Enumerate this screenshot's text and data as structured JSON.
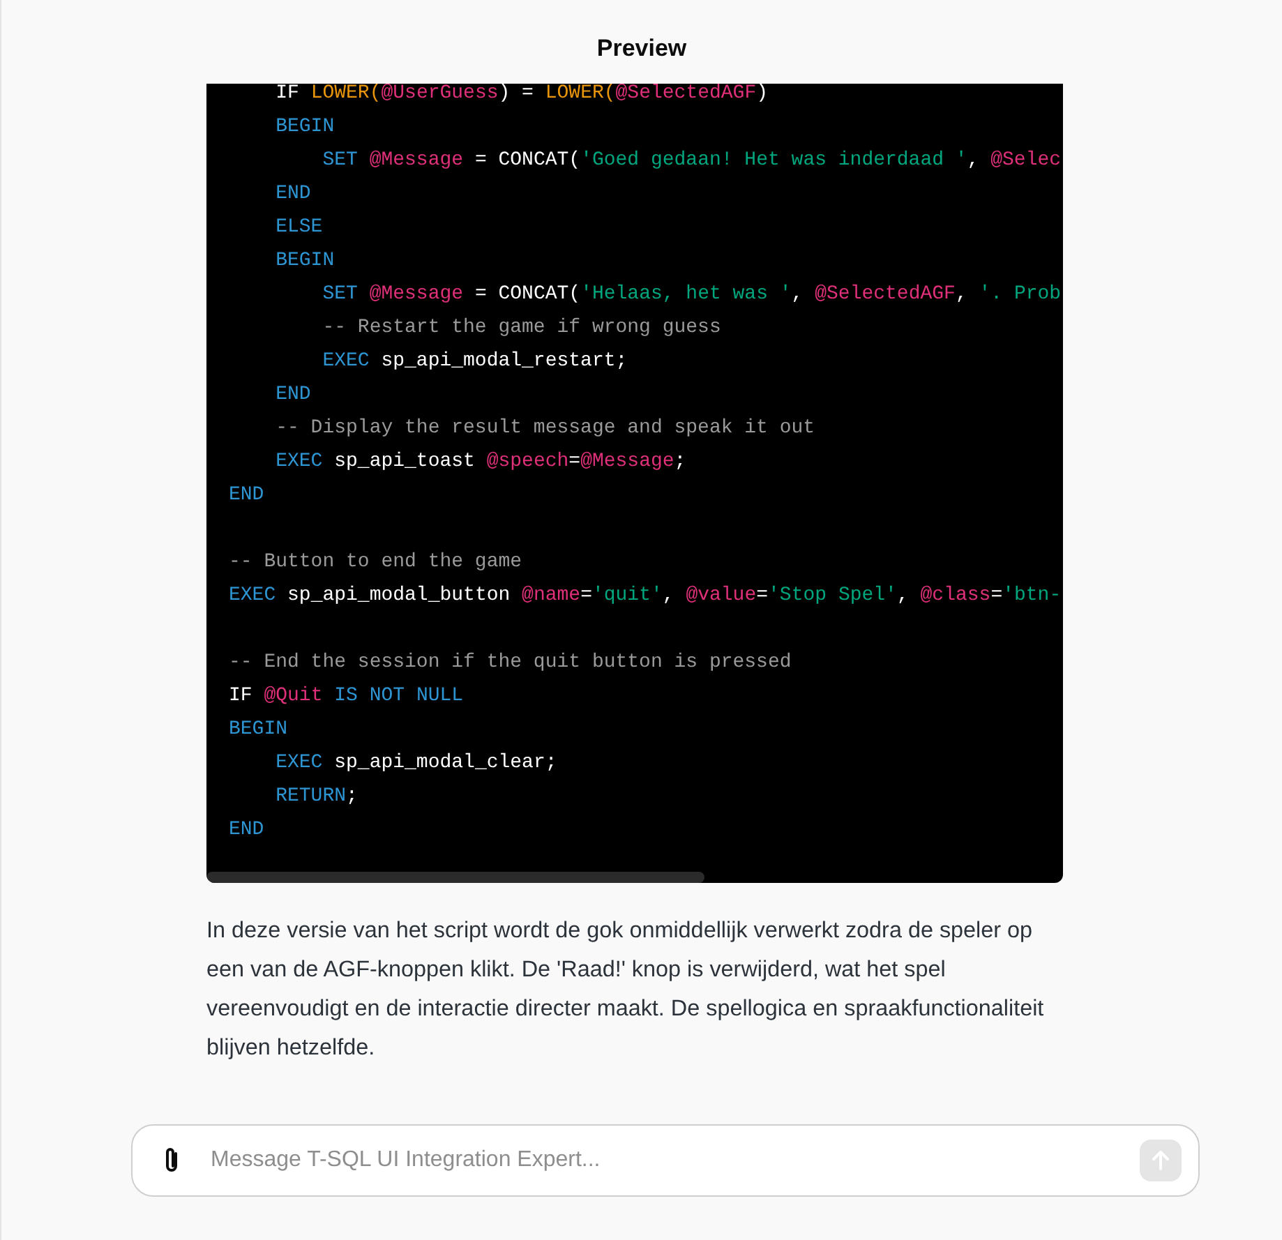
{
  "header": {
    "title": "Preview"
  },
  "code": {
    "lines": [
      {
        "kind": "code",
        "tokens": [
          {
            "kind": "plain",
            "text": "    IF "
          },
          {
            "kind": "func",
            "text": "LOWER("
          },
          {
            "kind": "var",
            "text": "@UserGuess"
          },
          {
            "kind": "plain",
            "text": ") = "
          },
          {
            "kind": "func",
            "text": "LOWER("
          },
          {
            "kind": "var",
            "text": "@SelectedAGF"
          },
          {
            "kind": "plain",
            "text": ")"
          }
        ]
      },
      {
        "kind": "code",
        "tokens": [
          {
            "kind": "keyword",
            "text": "    BEGIN"
          }
        ]
      },
      {
        "kind": "code",
        "tokens": [
          {
            "kind": "keyword",
            "text": "        SET "
          },
          {
            "kind": "var",
            "text": "@Message"
          },
          {
            "kind": "plain",
            "text": " = CONCAT("
          },
          {
            "kind": "string",
            "text": "'Goed gedaan! Het was inderdaad '"
          },
          {
            "kind": "plain",
            "text": ", "
          },
          {
            "kind": "var",
            "text": "@Selec"
          }
        ]
      },
      {
        "kind": "code",
        "tokens": [
          {
            "kind": "keyword",
            "text": "    END"
          }
        ]
      },
      {
        "kind": "code",
        "tokens": [
          {
            "kind": "keyword",
            "text": "    ELSE"
          }
        ]
      },
      {
        "kind": "code",
        "tokens": [
          {
            "kind": "keyword",
            "text": "    BEGIN"
          }
        ]
      },
      {
        "kind": "code",
        "tokens": [
          {
            "kind": "keyword",
            "text": "        SET "
          },
          {
            "kind": "var",
            "text": "@Message"
          },
          {
            "kind": "plain",
            "text": " = CONCAT("
          },
          {
            "kind": "string",
            "text": "'Helaas, het was '"
          },
          {
            "kind": "plain",
            "text": ", "
          },
          {
            "kind": "var",
            "text": "@SelectedAGF"
          },
          {
            "kind": "plain",
            "text": ", "
          },
          {
            "kind": "string",
            "text": "'. Prob"
          }
        ]
      },
      {
        "kind": "code",
        "tokens": [
          {
            "kind": "comment",
            "text": "        -- Restart the game if wrong guess"
          }
        ]
      },
      {
        "kind": "code",
        "tokens": [
          {
            "kind": "keyword",
            "text": "        EXEC "
          },
          {
            "kind": "plain",
            "text": "sp_api_modal_restart;"
          }
        ]
      },
      {
        "kind": "code",
        "tokens": [
          {
            "kind": "keyword",
            "text": "    END"
          }
        ]
      },
      {
        "kind": "code",
        "tokens": [
          {
            "kind": "comment",
            "text": "    -- Display the result message and speak it out"
          }
        ]
      },
      {
        "kind": "code",
        "tokens": [
          {
            "kind": "keyword",
            "text": "    EXEC "
          },
          {
            "kind": "plain",
            "text": "sp_api_toast "
          },
          {
            "kind": "var",
            "text": "@speech"
          },
          {
            "kind": "plain",
            "text": "="
          },
          {
            "kind": "var",
            "text": "@Message"
          },
          {
            "kind": "plain",
            "text": ";"
          }
        ]
      },
      {
        "kind": "code",
        "tokens": [
          {
            "kind": "keyword",
            "text": "END"
          }
        ]
      },
      {
        "kind": "blank"
      },
      {
        "kind": "code",
        "tokens": [
          {
            "kind": "comment",
            "text": "-- Button to end the game"
          }
        ]
      },
      {
        "kind": "code",
        "tokens": [
          {
            "kind": "keyword",
            "text": "EXEC "
          },
          {
            "kind": "plain",
            "text": "sp_api_modal_button "
          },
          {
            "kind": "var",
            "text": "@name"
          },
          {
            "kind": "plain",
            "text": "="
          },
          {
            "kind": "string",
            "text": "'quit'"
          },
          {
            "kind": "plain",
            "text": ", "
          },
          {
            "kind": "var",
            "text": "@value"
          },
          {
            "kind": "plain",
            "text": "="
          },
          {
            "kind": "string",
            "text": "'Stop Spel'"
          },
          {
            "kind": "plain",
            "text": ", "
          },
          {
            "kind": "var",
            "text": "@class"
          },
          {
            "kind": "plain",
            "text": "="
          },
          {
            "kind": "string",
            "text": "'btn-"
          }
        ]
      },
      {
        "kind": "blank"
      },
      {
        "kind": "code",
        "tokens": [
          {
            "kind": "comment",
            "text": "-- End the session if the quit button is pressed"
          }
        ]
      },
      {
        "kind": "code",
        "tokens": [
          {
            "kind": "plain",
            "text": "IF "
          },
          {
            "kind": "var",
            "text": "@Quit"
          },
          {
            "kind": "keyword",
            "text": " IS NOT NULL"
          }
        ]
      },
      {
        "kind": "code",
        "tokens": [
          {
            "kind": "keyword",
            "text": "BEGIN"
          }
        ]
      },
      {
        "kind": "code",
        "tokens": [
          {
            "kind": "keyword",
            "text": "    EXEC "
          },
          {
            "kind": "plain",
            "text": "sp_api_modal_clear;"
          }
        ]
      },
      {
        "kind": "code",
        "tokens": [
          {
            "kind": "keyword",
            "text": "    RETURN"
          },
          {
            "kind": "plain",
            "text": ";"
          }
        ]
      },
      {
        "kind": "code",
        "tokens": [
          {
            "kind": "keyword",
            "text": "END"
          }
        ]
      }
    ]
  },
  "message": "In deze versie van het script wordt de gok onmiddellijk verwerkt zodra de speler op een van de AGF-knoppen klikt. De 'Raad!' knop is verwijderd, wat het spel vereenvoudigt en de interactie directer maakt. De spellogica en spraakfunctionaliteit blijven hetzelfde.",
  "composer": {
    "placeholder": "Message T-SQL UI Integration Expert..."
  }
}
